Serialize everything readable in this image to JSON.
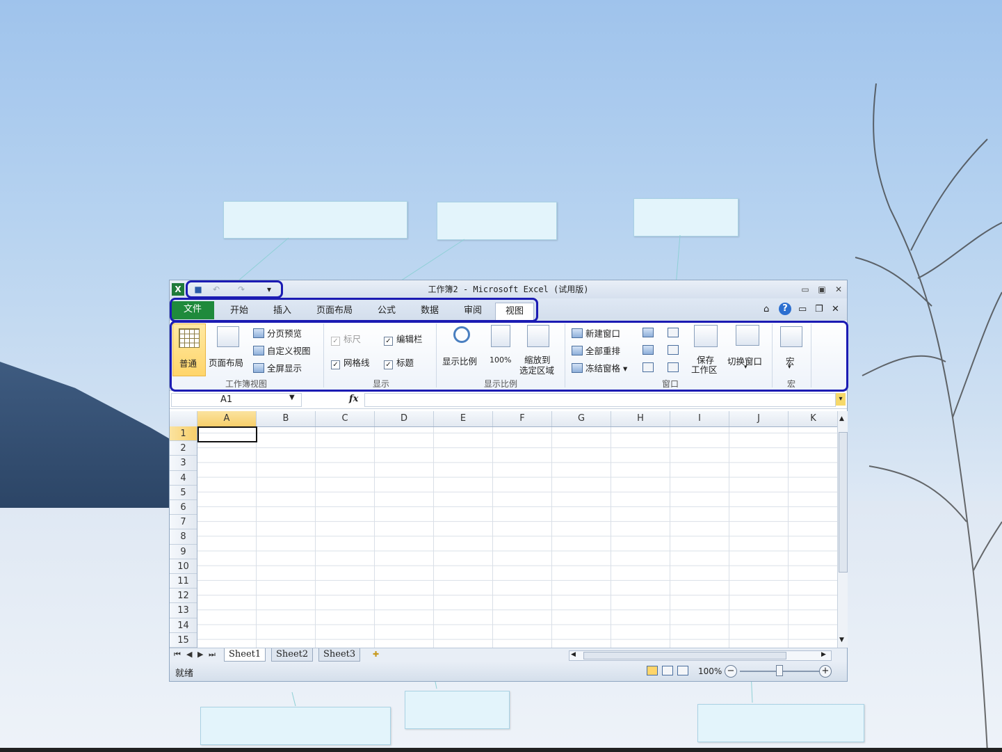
{
  "window": {
    "title": "工作簿2 - Microsoft Excel (试用版)",
    "app_icon": "X"
  },
  "quick_access": {
    "save_icon": "save-icon",
    "undo_icon": "undo-icon",
    "redo_icon": "redo-icon",
    "customize_icon": "customize-icon"
  },
  "tabs": [
    {
      "label": "文件"
    },
    {
      "label": "开始"
    },
    {
      "label": "插入"
    },
    {
      "label": "页面布局"
    },
    {
      "label": "公式"
    },
    {
      "label": "数据"
    },
    {
      "label": "审阅"
    },
    {
      "label": "视图"
    }
  ],
  "ribbon": {
    "workbook_views": {
      "normal": "普通",
      "page_layout": "页面布局",
      "page_break": "分页预览",
      "custom_views": "自定义视图",
      "full_screen": "全屏显示",
      "group_label": "工作簿视图"
    },
    "show": {
      "ruler": "标尺",
      "formula_bar": "编辑栏",
      "gridlines": "网格线",
      "headings": "标题",
      "group_label": "显示"
    },
    "zoom": {
      "zoom": "显示比例",
      "zoom_100": "100%",
      "zoom_selection_line1": "缩放到",
      "zoom_selection_line2": "选定区域",
      "group_label": "显示比例"
    },
    "window": {
      "new_window": "新建窗口",
      "arrange_all": "全部重排",
      "freeze_panes": "冻结窗格",
      "save_ws_line1": "保存",
      "save_ws_line2": "工作区",
      "switch_windows": "切换窗口",
      "group_label": "窗口"
    },
    "macros": {
      "macros": "宏",
      "group_label": "宏"
    }
  },
  "formula_bar": {
    "name_box": "A1",
    "fx": "fx",
    "value": ""
  },
  "grid": {
    "columns": [
      "A",
      "B",
      "C",
      "D",
      "E",
      "F",
      "G",
      "H",
      "I",
      "J",
      "K"
    ],
    "rows": [
      "1",
      "2",
      "3",
      "4",
      "5",
      "6",
      "7",
      "8",
      "9",
      "10",
      "11",
      "12",
      "13",
      "14",
      "15"
    ]
  },
  "sheets": [
    {
      "label": "Sheet1"
    },
    {
      "label": "Sheet2"
    },
    {
      "label": "Sheet3"
    }
  ],
  "status": {
    "ready": "就绪",
    "zoom_level": "100%"
  },
  "colors": {
    "file_tab": "#1f8a3c",
    "highlight": "#1b1bb3",
    "callout": "#e3f4fb"
  }
}
